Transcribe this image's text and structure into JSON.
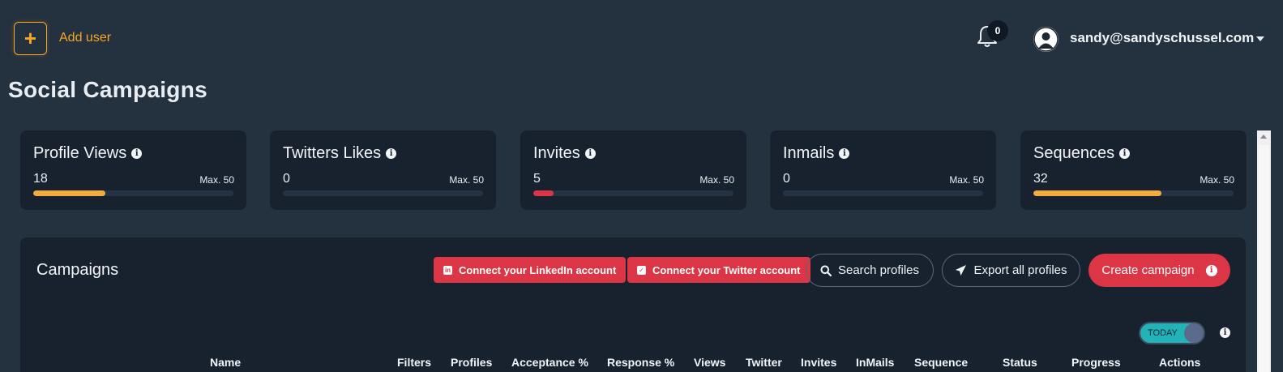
{
  "header": {
    "add_user_icon": "plus-icon",
    "add_user_label": "Add user",
    "notifications_count": "0",
    "user_email": "sandy@sandyschussel.com"
  },
  "page_title": "Social Campaigns",
  "stats": [
    {
      "title": "Profile Views",
      "value": "18",
      "max": "Max. 50",
      "fill_fraction": 0.36,
      "color": "#f6ab3e"
    },
    {
      "title": "Twitters Likes",
      "value": "0",
      "max": "Max. 50",
      "fill_fraction": 0,
      "color": "#f6ab3e"
    },
    {
      "title": "Invites",
      "value": "5",
      "max": "Max. 50",
      "fill_fraction": 0.1,
      "color": "#dc3545"
    },
    {
      "title": "Inmails",
      "value": "0",
      "max": "Max. 50",
      "fill_fraction": 0,
      "color": "#f6ab3e"
    },
    {
      "title": "Sequences",
      "value": "32",
      "max": "Max. 50",
      "fill_fraction": 0.64,
      "color": "#f6ab3e"
    }
  ],
  "campaigns": {
    "title": "Campaigns",
    "connect_linkedin": "Connect your LinkedIn account",
    "connect_twitter": "Connect your Twitter account",
    "search_profiles": "Search profiles",
    "export_profiles": "Export all profiles",
    "create_campaign": "Create campaign",
    "toggle_label": "TODAY",
    "columns": [
      "Name",
      "Filters",
      "Profiles",
      "Acceptance %",
      "Response %",
      "Views",
      "Twitter",
      "Invites",
      "InMails",
      "Sequence",
      "Status",
      "Progress",
      "Actions"
    ]
  },
  "colors": {
    "accent_orange": "#f6a623",
    "danger_red": "#dc3545",
    "toggle_teal": "#21b3b8"
  }
}
